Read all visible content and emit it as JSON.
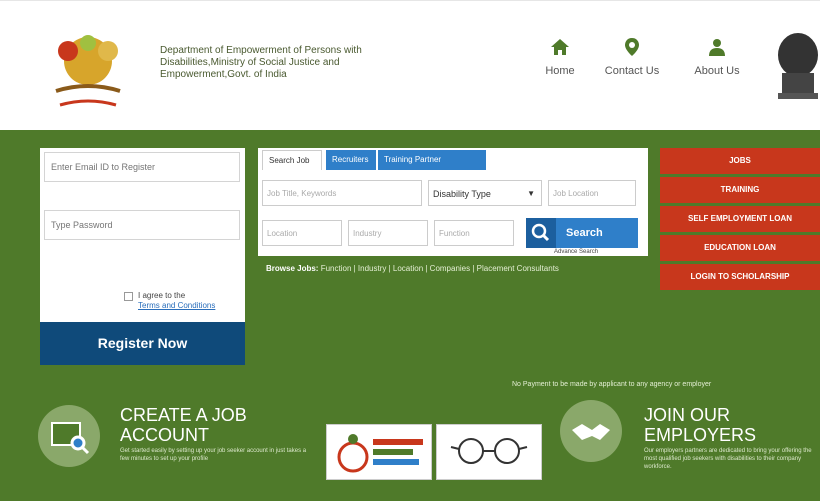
{
  "header": {
    "dept_name": "Department of Empowerment of Persons with Disabilities,Ministry of Social Justice and Empowerment,Govt. of India",
    "nav": [
      {
        "label": "Home",
        "icon": "home-icon"
      },
      {
        "label": "Contact Us",
        "icon": "location-pin-icon"
      },
      {
        "label": "About Us",
        "icon": "person-icon"
      }
    ]
  },
  "login": {
    "email_placeholder": "Enter Email ID to Register",
    "password_placeholder": "Type Password",
    "agree_text": "I agree to the",
    "terms_link": "Terms and Conditions",
    "register_label": "Register Now"
  },
  "search": {
    "tabs": [
      "Search Job",
      "Recruiters",
      "Training Partner"
    ],
    "keyword_placeholder": "Job Title, Keywords",
    "disability_label": "Disability Type",
    "location_placeholder": "Job Location",
    "field_a": "Location",
    "field_b": "Industry",
    "field_c": "Function",
    "search_label": "Search",
    "advanced_label": "Advance Search",
    "browse_label": "Browse Jobs:",
    "browse_links": "Function | Industry | Location | Companies | Placement Consultants"
  },
  "side_buttons": [
    "JOBS",
    "TRAINING",
    "SELF EMPLOYMENT LOAN",
    "EDUCATION LOAN",
    "LOGIN TO SCHOLARSHIP"
  ],
  "notice": "No Payment to be made by applicant to any agency or employer",
  "bottom": {
    "create_line1": "CREATE A JOB",
    "create_line2": "ACCOUNT",
    "create_desc": "Get started easily by setting up your job seeker account in just takes a few minutes to set up your profile",
    "join_line1": "JOIN OUR",
    "join_line2": "EMPLOYERS",
    "join_desc": "Our employers partners are dedicated to bring your offering the most qualified job seekers with disabilities to their company workforce."
  },
  "colors": {
    "band_green": "#4f7a2a",
    "register_blue": "#0f4a7a",
    "tab_blue": "#2f7fc9",
    "red_button": "#c8371c"
  }
}
